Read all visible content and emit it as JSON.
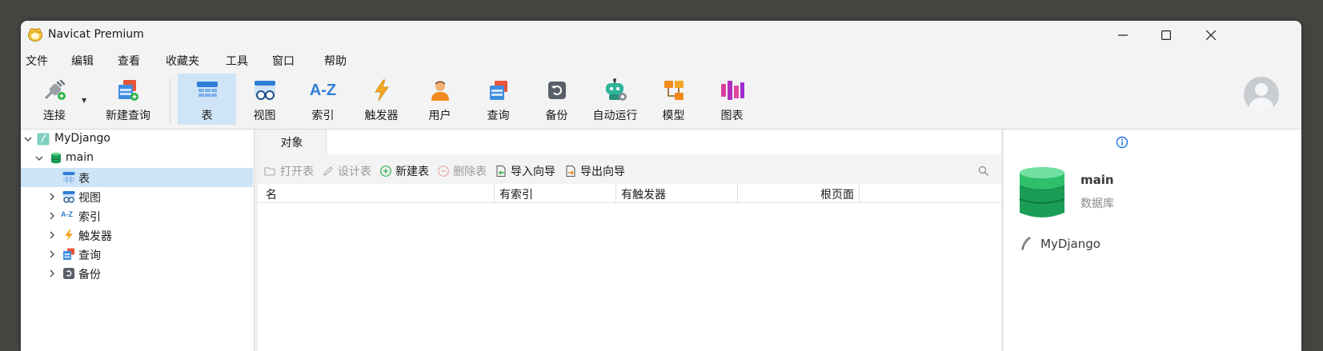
{
  "window": {
    "title": "Navicat Premium"
  },
  "menu": [
    "文件",
    "编辑",
    "查看",
    "收藏夹",
    "工具",
    "窗口",
    "帮助"
  ],
  "toolbar": {
    "connect": "连接",
    "new_query": "新建查询",
    "table": "表",
    "view": "视图",
    "index": "索引",
    "trigger": "触发器",
    "user": "用户",
    "query": "查询",
    "backup": "备份",
    "automation": "自动运行",
    "model": "模型",
    "chart": "图表",
    "index_icon_text": "A-Z"
  },
  "tree": {
    "connection": "MyDjango",
    "database": "main",
    "items": [
      {
        "label": "表",
        "selected": true
      },
      {
        "label": "视图"
      },
      {
        "label": "索引"
      },
      {
        "label": "触发器"
      },
      {
        "label": "查询"
      },
      {
        "label": "备份"
      }
    ],
    "small_index_icon_text": "A-Z"
  },
  "tabs": {
    "objects": "对象"
  },
  "objbar": {
    "open_table": "打开表",
    "design_table": "设计表",
    "new_table": "新建表",
    "delete_table": "删除表",
    "import_wizard": "导入向导",
    "export_wizard": "导出向导"
  },
  "grid": {
    "columns": [
      "名",
      "有索引",
      "有触发器",
      "根页面"
    ]
  },
  "info": {
    "name": "main",
    "type": "数据库",
    "connection": "MyDjango"
  },
  "colors": {
    "selected_bg": "#cce4f7",
    "active_tab_bg": "#cfe4f7",
    "db_green": "#1a9e55",
    "info_blue": "#1a73e8"
  }
}
